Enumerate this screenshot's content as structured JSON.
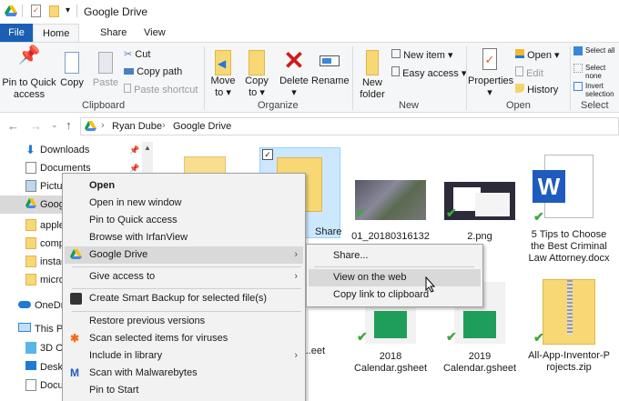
{
  "window": {
    "title": "Google Drive",
    "quick_access_dropdown": "▾"
  },
  "tabs": [
    {
      "label": "File"
    },
    {
      "label": "Home"
    },
    {
      "label": "Share"
    },
    {
      "label": "View"
    }
  ],
  "ribbon": {
    "clipboard": {
      "pin": "Pin to Quick access",
      "copy": "Copy",
      "paste": "Paste",
      "cut": "Cut",
      "copy_path": "Copy path",
      "paste_shortcut": "Paste shortcut",
      "group": "Clipboard"
    },
    "organize": {
      "move_to": "Move to",
      "copy_to": "Copy to",
      "delete": "Delete",
      "rename": "Rename",
      "group": "Organize"
    },
    "new": {
      "new_folder": "New folder",
      "new_item": "New item",
      "easy_access": "Easy access",
      "group": "New"
    },
    "open": {
      "properties": "Properties",
      "open": "Open",
      "edit": "Edit",
      "history": "History",
      "group": "Open"
    },
    "select": {
      "select_all": "Select all",
      "select_none": "Select none",
      "invert": "Invert selection",
      "group": "Select"
    }
  },
  "address": {
    "crumbs": [
      "Ryan Dube",
      "Google Drive"
    ]
  },
  "nav": {
    "items": [
      {
        "label": "Downloads",
        "icon": "download-icon"
      },
      {
        "label": "Documents",
        "icon": "document-icon"
      },
      {
        "label": "Pictures",
        "icon": "pictures-icon"
      },
      {
        "label": "Google Drive",
        "icon": "google-drive-icon"
      },
      {
        "label": "apple",
        "icon": "folder-icon"
      },
      {
        "label": "computer",
        "icon": "folder-icon"
      },
      {
        "label": "instagram",
        "icon": "folder-icon"
      },
      {
        "label": "microsoft",
        "icon": "folder-icon"
      },
      {
        "label": "OneDrive",
        "icon": "cloud-icon"
      },
      {
        "label": "This PC",
        "icon": "computer-icon"
      },
      {
        "label": "3D Objects",
        "icon": "cube-icon"
      },
      {
        "label": "Desktop",
        "icon": "desktop-icon"
      },
      {
        "label": "Documents",
        "icon": "document-icon"
      }
    ]
  },
  "files": [
    {
      "name": "Share"
    },
    {
      "name": "01_20180316132216.jpg"
    },
    {
      "name": "2.png"
    },
    {
      "name": "5 Tips to Choose the Best Criminal Law Attorney.docx"
    },
    {
      "name": "...nce ...eet"
    },
    {
      "name": "2018 Calendar.gsheet"
    },
    {
      "name": "2019 Calendar.gsheet"
    },
    {
      "name": "All-App-Inventor-Projects.zip"
    }
  ],
  "context_menu": {
    "items": [
      {
        "label": "Open"
      },
      {
        "label": "Open in new window"
      },
      {
        "label": "Pin to Quick access"
      },
      {
        "label": "Browse with IrfanView"
      },
      {
        "label": "Google Drive"
      },
      {
        "label": "Give access to"
      },
      {
        "label": "Create Smart Backup for selected file(s)"
      },
      {
        "label": "Restore previous versions"
      },
      {
        "label": "Scan selected items for viruses"
      },
      {
        "label": "Include in library"
      },
      {
        "label": "Scan with Malwarebytes"
      },
      {
        "label": "Pin to Start"
      }
    ]
  },
  "submenu": {
    "items": [
      {
        "label": "Share..."
      },
      {
        "label": "View on the web"
      },
      {
        "label": "Copy link to clipboard"
      }
    ]
  },
  "colors": {
    "file_tab": "#1a5fb4",
    "highlight": "#d9d9d9",
    "selected": "#cce8ff",
    "sync_check": "#3ea83e"
  }
}
